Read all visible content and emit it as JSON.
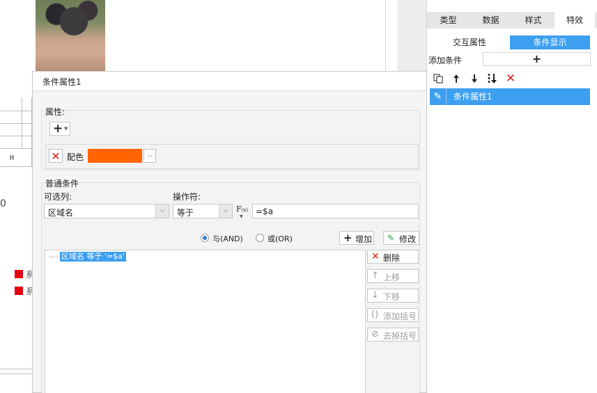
{
  "background": {
    "grid_col_label": "H",
    "axis_zero": "0",
    "legend_items": [
      {
        "label": "系",
        "color": "#e60012"
      },
      {
        "label": "系",
        "color": "#e60012"
      }
    ]
  },
  "right_panel": {
    "tabs": [
      {
        "label": "类型"
      },
      {
        "label": "数据"
      },
      {
        "label": "样式"
      },
      {
        "label": "特效",
        "active": true
      }
    ],
    "subtabs": [
      {
        "label": "交互属性"
      },
      {
        "label": "条件显示",
        "active": true
      }
    ],
    "add_condition_label": "添加条件",
    "add_button_icon": "plus-icon",
    "toolbar_icons": [
      "copy-icon",
      "arrow-up-icon",
      "arrow-down-icon",
      "sort-icon",
      "delete-icon"
    ],
    "list_items": [
      {
        "label": "条件属性1",
        "icon": "edit-icon",
        "selected": true
      }
    ]
  },
  "dialog": {
    "title": "条件属性1",
    "property_section": {
      "label": "属性:",
      "add_button_icon": "plus-icon",
      "rows": [
        {
          "label": "配色",
          "color": "#ff6400"
        }
      ]
    },
    "condition_section": {
      "label": "普通条件",
      "column_label": "可选列:",
      "column_value": "区域名",
      "operator_label": "操作符:",
      "operator_value": "等于",
      "fx_label": "F(x)",
      "value": "=$a",
      "radio_and": "与(AND)",
      "radio_or": "或(OR)",
      "logic": "AND",
      "add_button": "增加",
      "modify_button": "修改",
      "conditions": [
        "区域名 等于 '=$a'"
      ],
      "side_buttons": [
        {
          "label": "删除",
          "icon": "delete-icon",
          "enabled": true
        },
        {
          "label": "上移",
          "icon": "arrow-up-icon",
          "enabled": false
        },
        {
          "label": "下移",
          "icon": "arrow-down-icon",
          "enabled": false
        },
        {
          "label": "添加括号",
          "icon": "add-bracket-icon",
          "enabled": false
        },
        {
          "label": "去掉括号",
          "icon": "remove-bracket-icon",
          "enabled": false
        }
      ]
    }
  }
}
